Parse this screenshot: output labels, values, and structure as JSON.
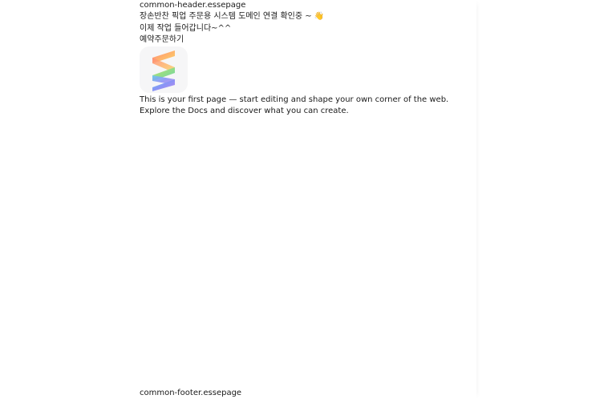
{
  "header": {
    "label": "common-header.essepage"
  },
  "notice": {
    "line1": "장손반찬 픽업 주문용 시스템 도메인 연결 확인중 ~ 👋",
    "line2": "이제 작업 들어갑니다~^^"
  },
  "order": {
    "label": "예약주문하기"
  },
  "logo": {
    "icon": "stripe-s-logo-icon"
  },
  "intro": {
    "line1": "This is your first page — start editing and shape your own corner of the web.",
    "line2_before": "Explore the ",
    "docs_link": "Docs",
    "line2_after": " and discover what you can create."
  },
  "footer": {
    "label": "common-footer.essepage"
  }
}
